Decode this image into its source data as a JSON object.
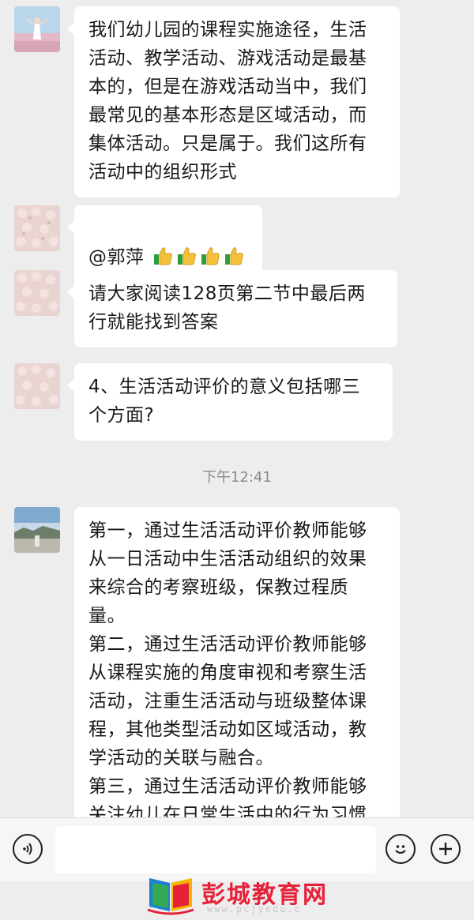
{
  "messages": [
    {
      "avatar": "avatar-woman-field",
      "text": "我们幼儿园的课程实施途径，生活\n活动、教学活动、游戏活动是最基\n本的，但是在游戏活动当中，我们\n最常见的基本形态是区域活动，而\n集体活动。只是属于。我们这所有\n活动中的组织形式"
    },
    {
      "avatar": "avatar-flowers",
      "text": "@郭萍 ",
      "emoji": [
        "thumbs-up-icon",
        "thumbs-up-icon",
        "thumbs-up-icon",
        "thumbs-up-icon"
      ]
    },
    {
      "avatar": "avatar-flowers",
      "text": "请大家阅读128页第二节中最后两\n行就能找到答案"
    },
    {
      "avatar": "avatar-flowers",
      "text": "4、生活活动评价的意义包括哪三\n个方面?"
    },
    {
      "avatar": "avatar-sky-landscape",
      "text": "第一，通过生活活动评价教师能够\n从一日活动中生活活动组织的效果\n来综合的考察班级，保教过程质\n量。\n第二，通过生活活动评价教师能够\n从课程实施的角度审视和考察生活\n活动，注重生活活动与班级整体课\n程，其他类型活动如区域活动，教\n学活动的关联与融合。\n第三，通过生活活动评价教师能够\n关注幼儿在日常生活中的行为习惯\n和学习表现，持续监测每位幼儿的"
    }
  ],
  "timestamp": "下午12:41",
  "input": {
    "voice_icon": "voice-icon",
    "emoji_icon": "emoji-icon",
    "plus_icon": "plus-icon",
    "value": ""
  },
  "watermark": {
    "name": "彭城教育网",
    "url": "www.pcjyedu.c"
  },
  "colors": {
    "background": "#ededed",
    "bubble": "#ffffff",
    "watermark_red": "#e6223a"
  }
}
